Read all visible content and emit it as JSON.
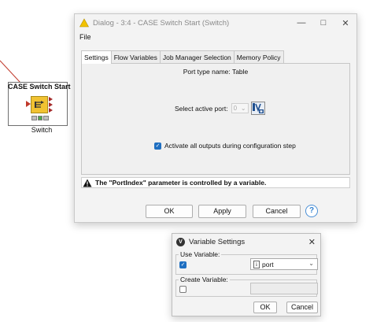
{
  "node": {
    "title": "CASE Switch Start",
    "label": "Switch",
    "icon": "switch-node-icon"
  },
  "dialog": {
    "title": "Dialog - 3:4 - CASE Switch Start (Switch)",
    "menu": "File",
    "tabs": [
      "Settings",
      "Flow Variables",
      "Job Manager Selection",
      "Memory Policy"
    ],
    "port_type": "Port type name: Table",
    "select_label": "Select active port:",
    "port_value": "0",
    "activate_label": "Activate all outputs during configuration step",
    "warning": "The \"PortIndex\" parameter is controlled by a variable.",
    "buttons": {
      "ok": "OK",
      "apply": "Apply",
      "cancel": "Cancel",
      "help": "?"
    }
  },
  "var_dialog": {
    "title": "Variable Settings",
    "use_label": "Use Variable:",
    "use_checked": true,
    "use_value": "port",
    "use_value_type": "i",
    "create_label": "Create Variable:",
    "create_checked": false,
    "create_value": "",
    "buttons": {
      "ok": "OK",
      "cancel": "Cancel"
    }
  },
  "colors": {
    "node_icon": "#f1c232",
    "accent": "#1f6fc1",
    "connection": "#c0392b",
    "warning": "#e6b800"
  }
}
